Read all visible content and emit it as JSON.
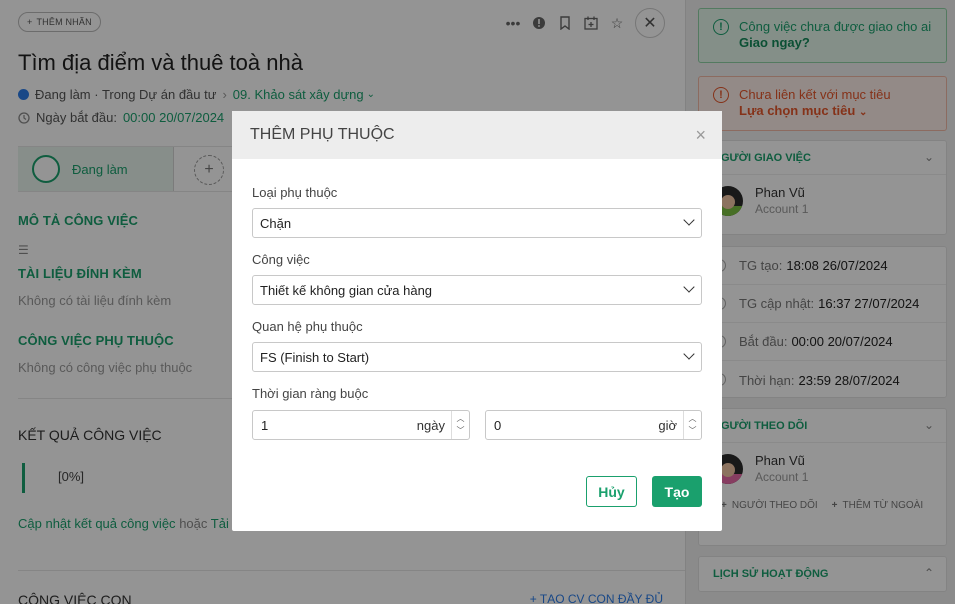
{
  "task": {
    "tag_button": "THÊM NHÃN",
    "title": "Tìm địa điểm và thuê toà nhà",
    "status_line": "Đang làm · Trong Dự án đầu tư",
    "stage_link": "09. Khảo sát xây dựng",
    "start_label": "Ngày bắt đầu:",
    "start_value": "00:00 20/07/2024",
    "status_cell": "Đang làm"
  },
  "sections": {
    "description": "MÔ TẢ CÔNG VIỆC",
    "attachments": "TÀI LIỆU ĐÍNH KÈM",
    "attachments_empty": "Không có tài liệu đính kèm",
    "dependencies": "CÔNG VIỆC PHỤ THUỘC",
    "dependencies_empty": "Không có công việc phụ thuộc",
    "result_title": "KẾT QUẢ CÔNG VIỆC",
    "result_progress": "[0%]",
    "update_link": "Cập nhật kết quả công việc",
    "update_or": "hoặc",
    "update_link2": "Tải l",
    "subtasks_title": "CÔNG VIỆC CON",
    "subtasks_add": "+ TẠO CV CON ĐẦY ĐỦ"
  },
  "right": {
    "alert_green_text": "Công việc chưa được giao cho ai",
    "alert_green_link": "Giao ngay?",
    "alert_red_text": "Chưa liên kết với mục tiêu",
    "alert_red_link": "Lựa chọn mục tiêu",
    "assigner_header": "NGƯỜI GIAO VIỆC",
    "assigner_name": "Phan Vũ",
    "assigner_account": "Account 1",
    "created_label": "TG tạo:",
    "created_value": "18:08 26/07/2024",
    "updated_label": "TG cập nhật:",
    "updated_value": "16:37 27/07/2024",
    "begin_label": "Bắt đầu:",
    "begin_value": "00:00 20/07/2024",
    "deadline_label": "Thời hạn:",
    "deadline_value": "23:59 28/07/2024",
    "followers_header": "NGƯỜI THEO DÕI",
    "follower_name": "Phan Vũ",
    "follower_account": "Account 1",
    "add_follower": "NGƯỜI THEO DÕI",
    "add_external": "THÊM TỪ NGOÀI",
    "history_header": "LỊCH SỬ HOẠT ĐỘNG"
  },
  "modal": {
    "title": "THÊM PHỤ THUỘC",
    "type_label": "Loại phụ thuộc",
    "type_value": "Chặn",
    "task_label": "Công việc",
    "task_value": "Thiết kế không gian cửa hàng",
    "relation_label": "Quan hệ phụ thuộc",
    "relation_value": "FS (Finish to Start)",
    "constraint_label": "Thời gian ràng buộc",
    "days_value": "1",
    "days_unit": "ngày",
    "hours_value": "0",
    "hours_unit": "giờ",
    "cancel": "Hủy",
    "create": "Tạo"
  },
  "colors": {
    "accent": "#1aa06d",
    "danger": "#e6562b",
    "link_blue": "#2b7de9"
  }
}
